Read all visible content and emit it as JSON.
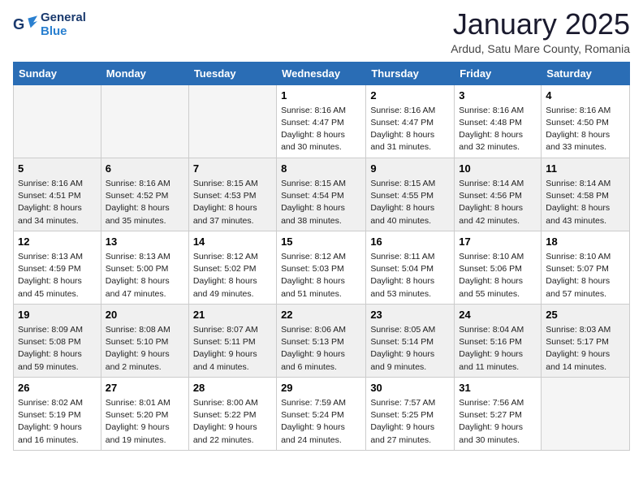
{
  "logo": {
    "general": "General",
    "blue": "Blue"
  },
  "title": "January 2025",
  "location": "Ardud, Satu Mare County, Romania",
  "days_of_week": [
    "Sunday",
    "Monday",
    "Tuesday",
    "Wednesday",
    "Thursday",
    "Friday",
    "Saturday"
  ],
  "weeks": [
    [
      {
        "day": "",
        "info": ""
      },
      {
        "day": "",
        "info": ""
      },
      {
        "day": "",
        "info": ""
      },
      {
        "day": "1",
        "info": "Sunrise: 8:16 AM\nSunset: 4:47 PM\nDaylight: 8 hours\nand 30 minutes."
      },
      {
        "day": "2",
        "info": "Sunrise: 8:16 AM\nSunset: 4:47 PM\nDaylight: 8 hours\nand 31 minutes."
      },
      {
        "day": "3",
        "info": "Sunrise: 8:16 AM\nSunset: 4:48 PM\nDaylight: 8 hours\nand 32 minutes."
      },
      {
        "day": "4",
        "info": "Sunrise: 8:16 AM\nSunset: 4:50 PM\nDaylight: 8 hours\nand 33 minutes."
      }
    ],
    [
      {
        "day": "5",
        "info": "Sunrise: 8:16 AM\nSunset: 4:51 PM\nDaylight: 8 hours\nand 34 minutes."
      },
      {
        "day": "6",
        "info": "Sunrise: 8:16 AM\nSunset: 4:52 PM\nDaylight: 8 hours\nand 35 minutes."
      },
      {
        "day": "7",
        "info": "Sunrise: 8:15 AM\nSunset: 4:53 PM\nDaylight: 8 hours\nand 37 minutes."
      },
      {
        "day": "8",
        "info": "Sunrise: 8:15 AM\nSunset: 4:54 PM\nDaylight: 8 hours\nand 38 minutes."
      },
      {
        "day": "9",
        "info": "Sunrise: 8:15 AM\nSunset: 4:55 PM\nDaylight: 8 hours\nand 40 minutes."
      },
      {
        "day": "10",
        "info": "Sunrise: 8:14 AM\nSunset: 4:56 PM\nDaylight: 8 hours\nand 42 minutes."
      },
      {
        "day": "11",
        "info": "Sunrise: 8:14 AM\nSunset: 4:58 PM\nDaylight: 8 hours\nand 43 minutes."
      }
    ],
    [
      {
        "day": "12",
        "info": "Sunrise: 8:13 AM\nSunset: 4:59 PM\nDaylight: 8 hours\nand 45 minutes."
      },
      {
        "day": "13",
        "info": "Sunrise: 8:13 AM\nSunset: 5:00 PM\nDaylight: 8 hours\nand 47 minutes."
      },
      {
        "day": "14",
        "info": "Sunrise: 8:12 AM\nSunset: 5:02 PM\nDaylight: 8 hours\nand 49 minutes."
      },
      {
        "day": "15",
        "info": "Sunrise: 8:12 AM\nSunset: 5:03 PM\nDaylight: 8 hours\nand 51 minutes."
      },
      {
        "day": "16",
        "info": "Sunrise: 8:11 AM\nSunset: 5:04 PM\nDaylight: 8 hours\nand 53 minutes."
      },
      {
        "day": "17",
        "info": "Sunrise: 8:10 AM\nSunset: 5:06 PM\nDaylight: 8 hours\nand 55 minutes."
      },
      {
        "day": "18",
        "info": "Sunrise: 8:10 AM\nSunset: 5:07 PM\nDaylight: 8 hours\nand 57 minutes."
      }
    ],
    [
      {
        "day": "19",
        "info": "Sunrise: 8:09 AM\nSunset: 5:08 PM\nDaylight: 8 hours\nand 59 minutes."
      },
      {
        "day": "20",
        "info": "Sunrise: 8:08 AM\nSunset: 5:10 PM\nDaylight: 9 hours\nand 2 minutes."
      },
      {
        "day": "21",
        "info": "Sunrise: 8:07 AM\nSunset: 5:11 PM\nDaylight: 9 hours\nand 4 minutes."
      },
      {
        "day": "22",
        "info": "Sunrise: 8:06 AM\nSunset: 5:13 PM\nDaylight: 9 hours\nand 6 minutes."
      },
      {
        "day": "23",
        "info": "Sunrise: 8:05 AM\nSunset: 5:14 PM\nDaylight: 9 hours\nand 9 minutes."
      },
      {
        "day": "24",
        "info": "Sunrise: 8:04 AM\nSunset: 5:16 PM\nDaylight: 9 hours\nand 11 minutes."
      },
      {
        "day": "25",
        "info": "Sunrise: 8:03 AM\nSunset: 5:17 PM\nDaylight: 9 hours\nand 14 minutes."
      }
    ],
    [
      {
        "day": "26",
        "info": "Sunrise: 8:02 AM\nSunset: 5:19 PM\nDaylight: 9 hours\nand 16 minutes."
      },
      {
        "day": "27",
        "info": "Sunrise: 8:01 AM\nSunset: 5:20 PM\nDaylight: 9 hours\nand 19 minutes."
      },
      {
        "day": "28",
        "info": "Sunrise: 8:00 AM\nSunset: 5:22 PM\nDaylight: 9 hours\nand 22 minutes."
      },
      {
        "day": "29",
        "info": "Sunrise: 7:59 AM\nSunset: 5:24 PM\nDaylight: 9 hours\nand 24 minutes."
      },
      {
        "day": "30",
        "info": "Sunrise: 7:57 AM\nSunset: 5:25 PM\nDaylight: 9 hours\nand 27 minutes."
      },
      {
        "day": "31",
        "info": "Sunrise: 7:56 AM\nSunset: 5:27 PM\nDaylight: 9 hours\nand 30 minutes."
      },
      {
        "day": "",
        "info": ""
      }
    ]
  ]
}
